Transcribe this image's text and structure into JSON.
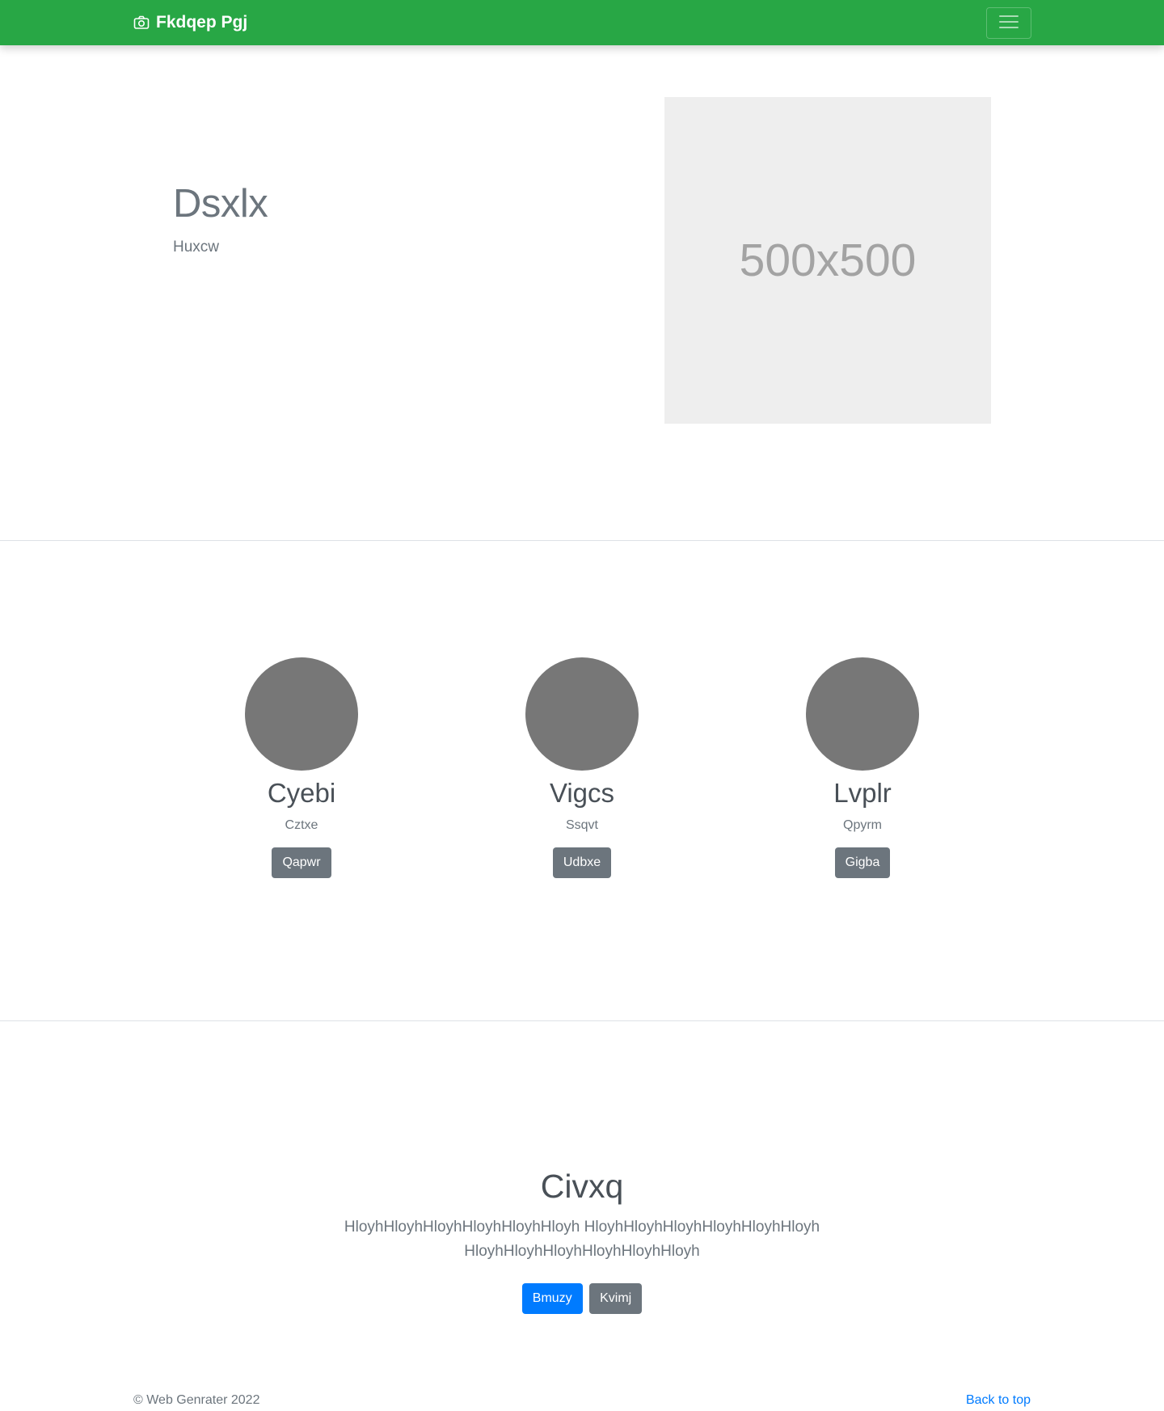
{
  "navbar": {
    "brand": "Fkdqep Pgj",
    "brand_icon": "camera-icon",
    "toggler_icon": "hamburger-menu-icon",
    "background": "#28a745"
  },
  "hero": {
    "title": "Dsxlx",
    "subtitle": "Huxcw",
    "image_label": "500x500"
  },
  "team": {
    "members": [
      {
        "name": "Cyebi",
        "role": "Cztxe",
        "button": "Qapwr"
      },
      {
        "name": "Vigcs",
        "role": "Ssqvt",
        "button": "Udbxe"
      },
      {
        "name": "Lvplr",
        "role": "Qpyrm",
        "button": "Gigba"
      }
    ]
  },
  "cta": {
    "title": "Civxq",
    "text": "HloyhHloyhHloyhHloyhHloyhHloyh HloyhHloyhHloyhHloyhHloyhHloyh HloyhHloyhHloyhHloyhHloyhHloyh",
    "primary_button": "Bmuzy",
    "secondary_button": "Kvimj"
  },
  "footer": {
    "copyright": "© Web Genrater 2022",
    "back_to_top": "Back to top"
  }
}
